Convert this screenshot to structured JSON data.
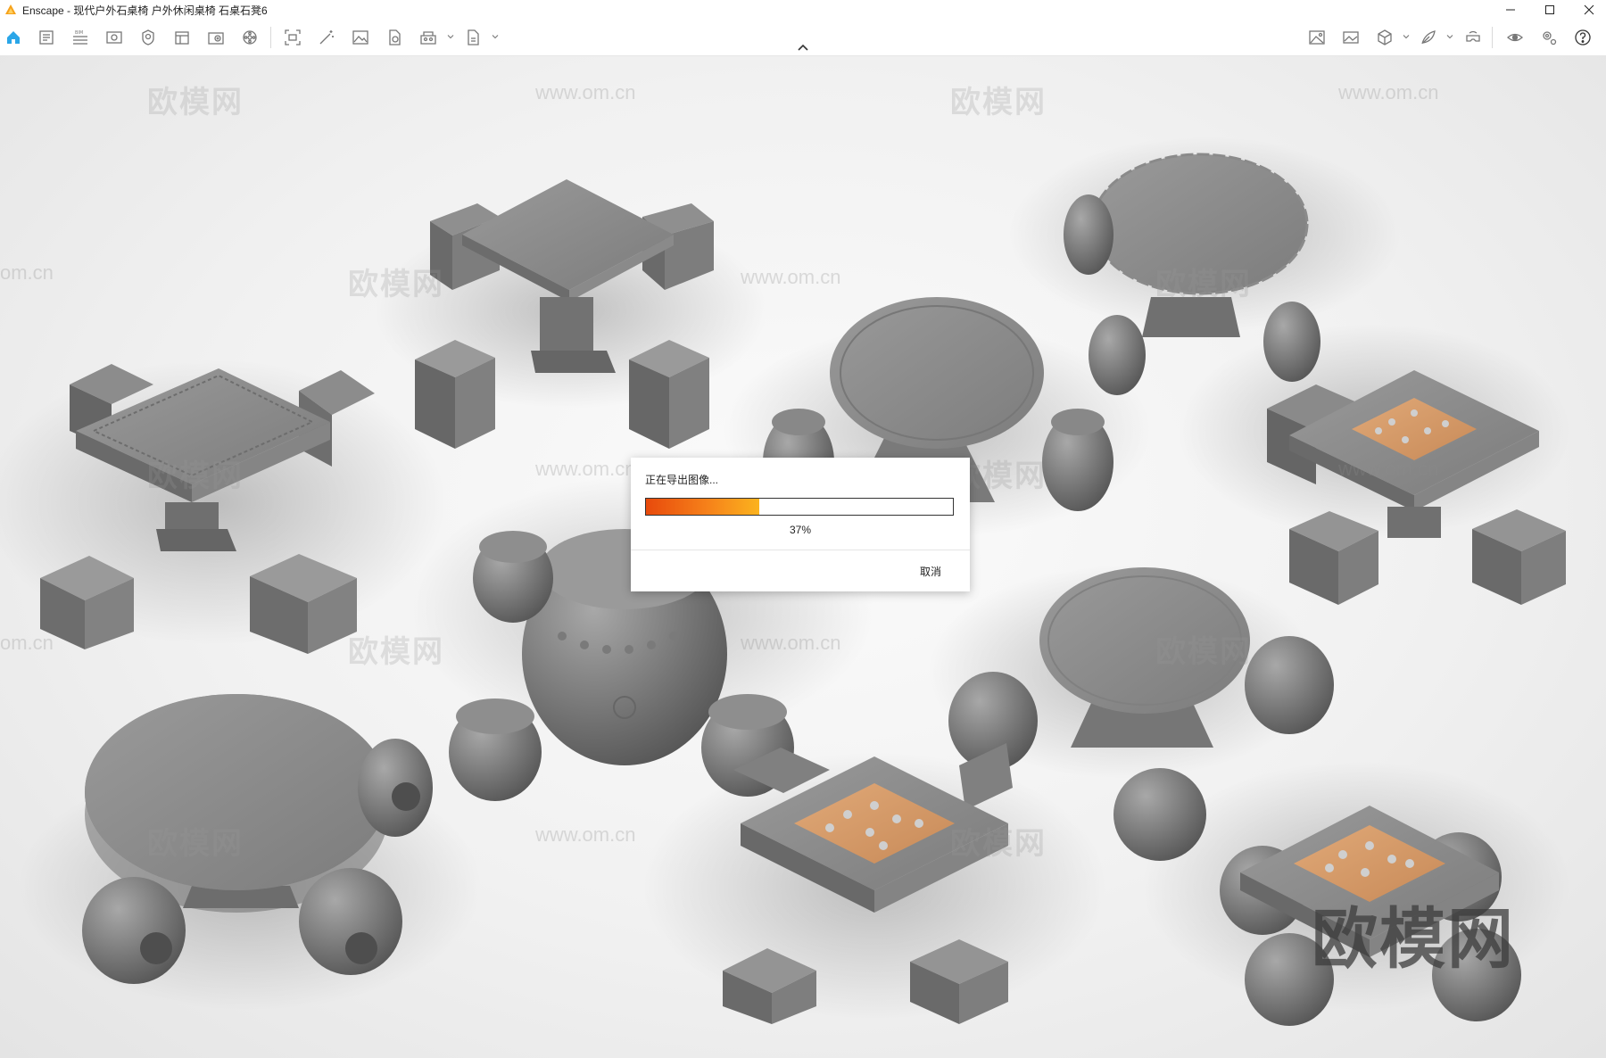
{
  "window": {
    "app_name": "Enscape",
    "title": "Enscape - 现代户外石桌椅 户外休闲桌椅 石桌石凳6",
    "accent_color": "#f6821a"
  },
  "toolbar": {
    "left_icons": [
      "home-icon",
      "project-icon",
      "bim-icon",
      "view-icon",
      "sun-icon",
      "asset-library-icon",
      "add-asset-icon",
      "material-icon",
      "screenshot-icon",
      "magic-wand-icon",
      "image-export-icon",
      "file-export-icon",
      "batch-render-icon",
      "document-icon"
    ],
    "right_icons": [
      "image-compare-icon",
      "gallery-icon",
      "cube-view-icon",
      "feather-icon",
      "vr-icon",
      "visibility-icon",
      "settings-icon",
      "help-icon"
    ]
  },
  "watermarks": {
    "site": "www.om.cn",
    "site_partial": "om.cn",
    "brand": "欧模网"
  },
  "dialog": {
    "status": "正在导出图像...",
    "progress": 0.37,
    "percent_label": "37%",
    "cancel_label": "取消"
  }
}
